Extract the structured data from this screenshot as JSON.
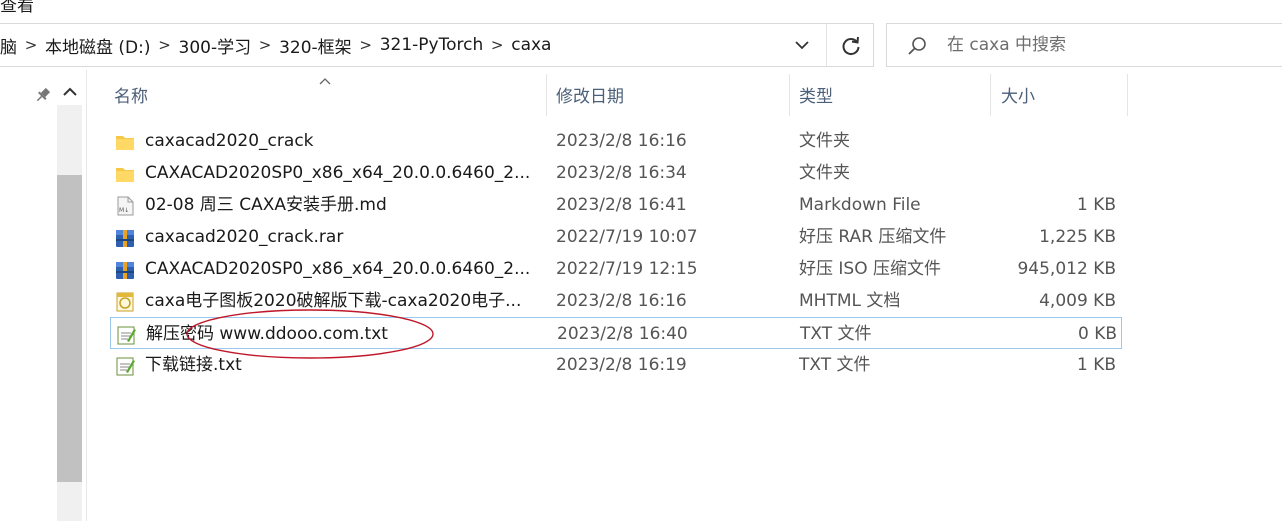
{
  "window": {
    "menu_partial": "查看"
  },
  "address": {
    "crumbs": [
      "脑",
      "本地磁盘 (D:)",
      "300-学习",
      "320-框架",
      "321-PyTorch",
      "caxa"
    ]
  },
  "search": {
    "placeholder": "在 caxa 中搜索"
  },
  "columns": {
    "name": "名称",
    "modified": "修改日期",
    "type": "类型",
    "size": "大小"
  },
  "files": [
    {
      "name": "caxacad2020_crack",
      "modified": "2023/2/8 16:16",
      "type": "文件夹",
      "size": "",
      "icon": "folder-icon"
    },
    {
      "name": "CAXACAD2020SP0_x86_x64_20.0.0.6460_2...",
      "modified": "2023/2/8 16:34",
      "type": "文件夹",
      "size": "",
      "icon": "folder-icon"
    },
    {
      "name": "02-08 周三 CAXA安装手册.md",
      "modified": "2023/2/8 16:41",
      "type": "Markdown File",
      "size": "1 KB",
      "icon": "markdown-file-icon"
    },
    {
      "name": "caxacad2020_crack.rar",
      "modified": "2022/7/19 10:07",
      "type": "好压 RAR 压缩文件",
      "size": "1,225 KB",
      "icon": "archive-icon"
    },
    {
      "name": "CAXACAD2020SP0_x86_x64_20.0.0.6460_2...",
      "modified": "2022/7/19 12:15",
      "type": "好压 ISO 压缩文件",
      "size": "945,012 KB",
      "icon": "archive-icon"
    },
    {
      "name": "caxa电子图板2020破解版下载-caxa2020电子...",
      "modified": "2023/2/8 16:16",
      "type": "MHTML 文档",
      "size": "4,009 KB",
      "icon": "mhtml-file-icon"
    },
    {
      "name": "解压密码 www.ddooo.com.txt",
      "modified": "2023/2/8 16:40",
      "type": "TXT 文件",
      "size": "0 KB",
      "icon": "text-file-icon",
      "selected": true
    },
    {
      "name": "下载链接.txt",
      "modified": "2023/2/8 16:19",
      "type": "TXT 文件",
      "size": "1 KB",
      "icon": "text-file-icon"
    }
  ],
  "colors": {
    "header_text": "#4c607a",
    "selection_border": "#99c9ef",
    "annotation": "#c0182a"
  }
}
